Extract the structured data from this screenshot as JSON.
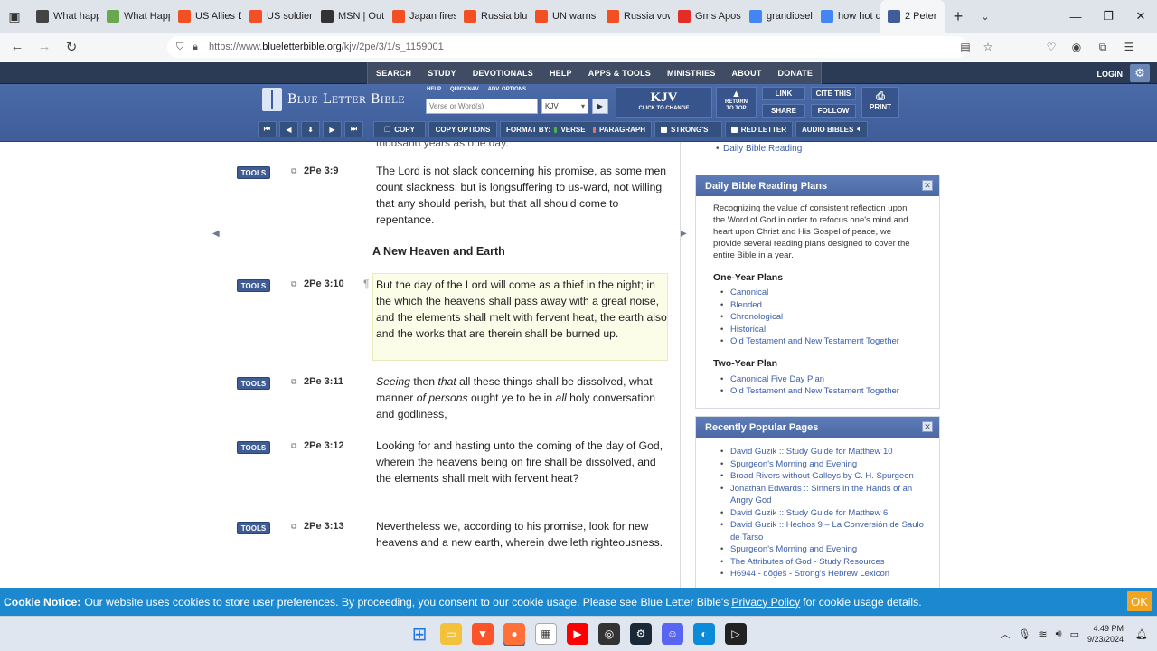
{
  "browser": {
    "tabs": [
      {
        "label": "What happ",
        "icon": "brave-icon",
        "color": "#444"
      },
      {
        "label": "What Happ",
        "icon": "bird-icon",
        "color": "#6aa84f"
      },
      {
        "label": "US Allies D",
        "icon": "msn-grid-icon",
        "color": "#f25022"
      },
      {
        "label": "US soldiers",
        "icon": "msn-grid-icon",
        "color": "#f25022"
      },
      {
        "label": "MSN | Out",
        "icon": "msn-icon",
        "color": "#333"
      },
      {
        "label": "Japan fires",
        "icon": "msn-grid-icon",
        "color": "#f25022"
      },
      {
        "label": "Russia blu",
        "icon": "msn-grid-icon",
        "color": "#f25022"
      },
      {
        "label": "UN warns",
        "icon": "msn-grid-icon",
        "color": "#f25022"
      },
      {
        "label": "Russia vow",
        "icon": "msn-grid-icon",
        "color": "#f25022"
      },
      {
        "label": "Gms Apost",
        "icon": "youtube-icon",
        "color": "#e52d27"
      },
      {
        "label": "grandiosel",
        "icon": "google-icon",
        "color": "#4285f4"
      },
      {
        "label": "how hot d",
        "icon": "google-icon",
        "color": "#4285f4"
      },
      {
        "label": "2 Peter",
        "icon": "blb-icon",
        "color": "#3e5d99",
        "active": true
      }
    ],
    "url_prefix": "https://www.",
    "url_host": "blueletterbible.org",
    "url_path": "/kjv/2pe/3/1/s_1159001"
  },
  "site": {
    "topnav": [
      "SEARCH",
      "STUDY",
      "DEVOTIONALS",
      "HELP",
      "APPS & TOOLS",
      "MINISTRIES",
      "ABOUT",
      "DONATE"
    ],
    "login": "LOGIN",
    "logo": "Blue Letter Bible",
    "mini_links": [
      "HELP",
      "QUICKNAV",
      "ADV. OPTIONS"
    ],
    "search_placeholder": "Verse or Word(s)",
    "version_value": "KJV",
    "kjv": "KJV",
    "kjv_sub": "CLICK TO CHANGE",
    "return_top_1": "RETURN",
    "return_top_2": "TO TOP",
    "link": "LINK",
    "cite": "CITE THIS",
    "share": "SHARE",
    "follow": "FOLLOW",
    "print": "PRINT",
    "copy": "COPY",
    "copy_options": "COPY OPTIONS",
    "format_by": "FORMAT BY:",
    "verse": "VERSE",
    "paragraph": "PARAGRAPH",
    "strongs": "STRONG'S",
    "red_letter": "RED LETTER",
    "audio_bibles": "AUDIO BIBLES"
  },
  "content": {
    "cut_top": "thousand years as one day.",
    "tools_label": "TOOLS",
    "heading": "A New Heaven and Earth",
    "verses": [
      {
        "ref": "2Pe 3:9",
        "text": "The Lord is not slack concerning his promise, as some men count slackness; but is longsuffering to us-ward, not willing that any should perish, but that all should come to repentance."
      },
      {
        "ref": "2Pe 3:10",
        "text": "But the day of the Lord will come as a thief in the night; in the which the heavens shall pass away with a great noise, and the elements shall melt with fervent heat, the earth also and the works that are therein shall be burned up."
      },
      {
        "ref": "2Pe 3:11",
        "text_html": "<i>Seeing</i> then <i>that</i> all these things shall be dissolved, what manner <i>of persons</i> ought ye to be in <i>all</i> holy conversation and godliness,"
      },
      {
        "ref": "2Pe 3:12",
        "text": "Looking for and hasting unto the coming of the day of God, wherein the heavens being on fire shall be dissolved, and the elements shall melt with fervent heat?"
      },
      {
        "ref": "2Pe 3:13",
        "text": "Nevertheless we, according to his promise, look for new heavens and a new earth, wherein dwelleth righteousness."
      }
    ]
  },
  "sidebar": {
    "cut_item": "Daily Bible Reading",
    "reading_plans": {
      "title": "Daily Bible Reading Plans",
      "intro": "Recognizing the value of consistent reflection upon the Word of God in order to refocus one's mind and heart upon Christ and His Gospel of peace, we provide several reading plans designed to cover the entire Bible in a year.",
      "one_year_title": "One-Year Plans",
      "one_year": [
        "Canonical",
        "Blended",
        "Chronological",
        "Historical",
        "Old Testament and New Testament Together"
      ],
      "two_year_title": "Two-Year Plan",
      "two_year": [
        "Canonical Five Day Plan",
        "Old Testament and New Testament Together"
      ]
    },
    "popular": {
      "title": "Recently Popular Pages",
      "items": [
        "David Guzik :: Study Guide for Matthew 10",
        "Spurgeon's Morning and Evening",
        "Broad Rivers without Galleys by C. H. Spurgeon",
        "Jonathan Edwards :: Sinners in the Hands of an Angry God",
        "David Guzik :: Study Guide for Matthew 6",
        "David Guzik :: Hechos 9 – La Conversión de Saulo de Tarso",
        "Spurgeon's Morning and Evening",
        "The Attributes of God - Study Resources",
        "H6944 - qōḏeš - Strong's Hebrew Lexicon"
      ]
    }
  },
  "cookie": {
    "label": "Cookie Notice:",
    "text": "Our website uses cookies to store user preferences. By proceeding, you consent to our cookie usage. Please see Blue Letter Bible's",
    "link": "Privacy Policy",
    "text_after": "for cookie usage details.",
    "ok": "OK"
  },
  "taskbar": {
    "time": "4:49 PM",
    "date": "9/23/2024"
  }
}
